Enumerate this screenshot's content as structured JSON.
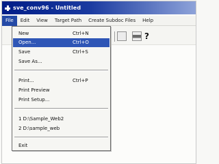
{
  "window": {
    "title": "sve_conv96 - Untitled"
  },
  "menubar": [
    {
      "label": "File"
    },
    {
      "label": "Edit"
    },
    {
      "label": "View"
    },
    {
      "label": "Target Path"
    },
    {
      "label": "Create Subdoc Files"
    },
    {
      "label": "Help"
    }
  ],
  "toolbar": {
    "help_glyph": "?"
  },
  "file_menu": {
    "items": [
      {
        "label": "New",
        "shortcut": "Ctrl+N"
      },
      {
        "label": "Open...",
        "shortcut": "Ctrl+O"
      },
      {
        "label": "Save",
        "shortcut": "Ctrl+S"
      },
      {
        "label": "Save As...",
        "shortcut": ""
      },
      {
        "label": "Print...",
        "shortcut": "Ctrl+P"
      },
      {
        "label": "Print Preview",
        "shortcut": ""
      },
      {
        "label": "Print Setup...",
        "shortcut": ""
      },
      {
        "label": "1 D:\\Sample_Web2",
        "shortcut": ""
      },
      {
        "label": "2 D:\\sample_web",
        "shortcut": ""
      },
      {
        "label": "Exit",
        "shortcut": ""
      }
    ]
  }
}
